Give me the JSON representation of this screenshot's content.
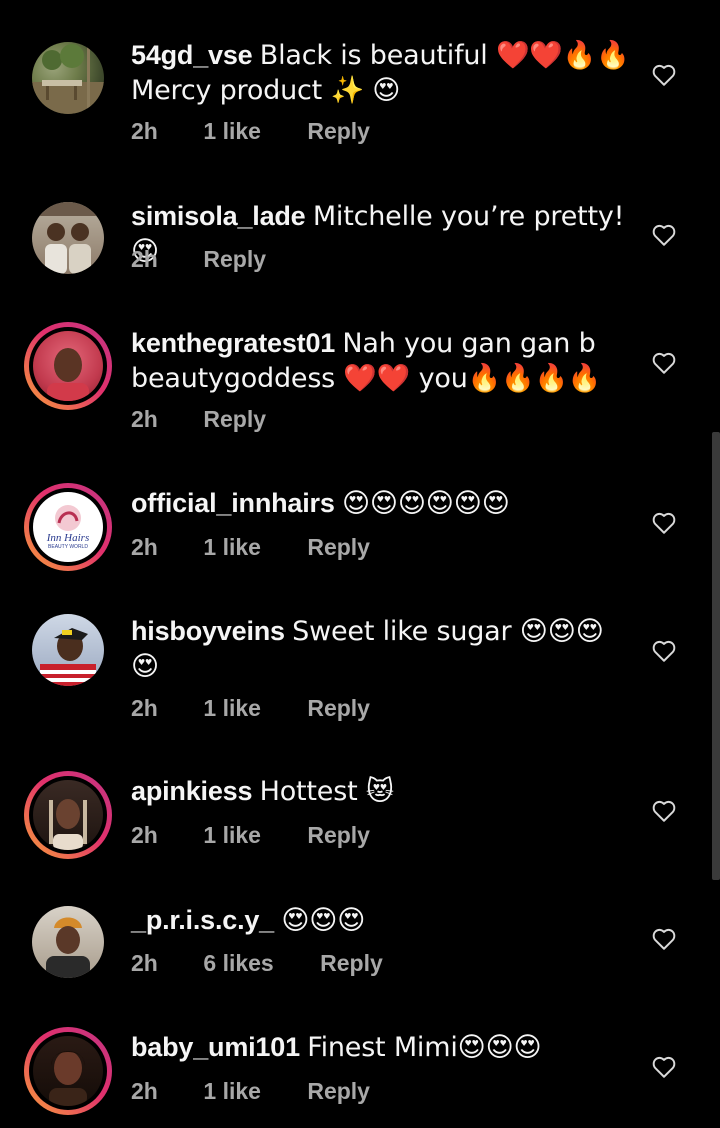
{
  "comments": [
    {
      "username": "54gd_vse",
      "text": "Black is beautiful ❤️❤️🔥🔥 Mercy product ✨ 😍",
      "time": "2h",
      "likes": "1 like",
      "reply": "Reply",
      "avatar": "avatar-forest-scene",
      "ring": false
    },
    {
      "username": "simisola_lade",
      "text": "Mitchelle you’re pretty!😍",
      "time": "2h",
      "likes": "",
      "reply": "Reply",
      "avatar": "avatar-two-people",
      "ring": false
    },
    {
      "username": "kenthegratest01",
      "text": "Nah you gan gan b beautygoddess ❤️❤️ you🔥🔥🔥🔥",
      "time": "2h",
      "likes": "",
      "reply": "Reply",
      "avatar": "avatar-woman-red",
      "ring": true
    },
    {
      "username": "official_innhairs",
      "text": "😍😍😍😍😍😍",
      "time": "2h",
      "likes": "1 like",
      "reply": "Reply",
      "avatar": "avatar-logo",
      "logo_text": "Inn Hairs",
      "logo_sub": "BEAUTY WORLD",
      "ring": true
    },
    {
      "username": "hisboyveins",
      "text": "Sweet like sugar 😍😍😍 😍",
      "time": "2h",
      "likes": "1 like",
      "reply": "Reply",
      "avatar": "avatar-man-cap",
      "ring": false
    },
    {
      "username": "apinkiess",
      "text": "Hottest 😻",
      "time": "2h",
      "likes": "1 like",
      "reply": "Reply",
      "avatar": "avatar-woman-braids",
      "ring": true
    },
    {
      "username": "_p.r.i.s.c.y_",
      "text": "😍😍😍",
      "time": "2h",
      "likes": "6 likes",
      "reply": "Reply",
      "avatar": "avatar-woman-headwrap",
      "ring": false
    },
    {
      "username": "baby_umi101",
      "text": "Finest Mimi😍😍😍",
      "time": "2h",
      "likes": "1 like",
      "reply": "Reply",
      "avatar": "avatar-woman-dark",
      "ring": true
    }
  ],
  "colors": {
    "background": "#000000",
    "text": "#f5f5f5",
    "meta": "#a8a8a8",
    "ring_start": "#f9a13a",
    "ring_end": "#c13584",
    "heart_outline": "#d9d9d9",
    "scrollbar": "#3a3a3a"
  },
  "icons": {
    "like": "heart-outline-icon"
  }
}
